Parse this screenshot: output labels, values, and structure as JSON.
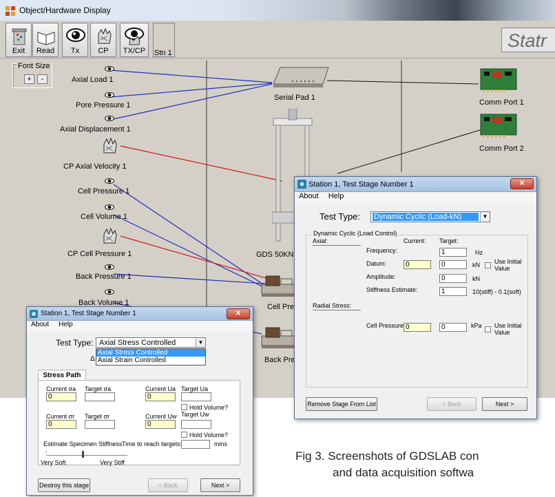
{
  "main_window": {
    "title": "Object/Hardware Display",
    "toolbar": {
      "exit": "Exit",
      "read": "Read",
      "tx": "Tx",
      "cp": "CP",
      "txcp": "TX/CP",
      "stn": "Stn 1",
      "brand_partial": "Statr"
    },
    "font_size": {
      "label": "Font Size",
      "plus": "+",
      "minus": "-"
    },
    "sensors": [
      "Axial Load 1",
      "Pore Pressure 1",
      "Axial Displacement 1",
      "CP Axial Velocity 1",
      "Cell Pressure 1",
      "Cell Volume 1",
      "CP Cell Pressure 1",
      "Back Pressure 1",
      "Back Volume 1"
    ],
    "hardware": {
      "serial_pad": "Serial Pad 1",
      "comm_port_1": "Comm Port 1",
      "comm_port_2": "Comm Port 2",
      "gds_partial": "GDS 50KN",
      "cell_pres_partial": "Cell Press",
      "back_pres_partial": "Back Pres"
    },
    "colors": {
      "blue_link": "#1f2fb8",
      "red_link": "#d01818"
    }
  },
  "dialog_dynamic": {
    "title": "Station 1, Test Stage Number 1",
    "menu": [
      "About",
      "Help"
    ],
    "test_type_label": "Test Type:",
    "test_type_value": "Dynamic Cyclic (Load-kN)",
    "group_label": "Dynamic Cyclic (Load Control)",
    "axial_label": "Axial:",
    "current_header": "Current:",
    "target_header": "Target:",
    "frequency": {
      "label": "Frequency:",
      "target": "1",
      "unit": "Hz"
    },
    "datum": {
      "label": "Datum:",
      "current": "0",
      "target": "0",
      "unit": "kN",
      "use_initial": "Use Initial Value"
    },
    "amplitude": {
      "label": "Amplitude:",
      "target": "0",
      "unit": "kN"
    },
    "stiffness": {
      "label": "Stiffness Estimate:",
      "target": "1",
      "note": "10(stiff) - 0.1(soft)"
    },
    "radial_label": "Radial Stress:",
    "cell_pressure": {
      "label": "Cell Pressure:",
      "current": "0",
      "target": "0",
      "unit": "kPa",
      "use_initial": "Use Initial Value"
    },
    "remove_button": "Remove Stage From List",
    "back_button": "< Back",
    "next_button": "Next >"
  },
  "dialog_stress": {
    "title": "Station 1, Test Stage Number 1",
    "menu": [
      "About",
      "Help"
    ],
    "test_type_label": "Test Type:",
    "test_type_value": "Axial Stress Controlled",
    "options": [
      "Axial Stress Controlled",
      "Axial Strain Controlled"
    ],
    "tab": "Stress Path",
    "current_sigma_a": "Current σa",
    "target_sigma_a": "Target σa",
    "current_ua": "Current Ua",
    "target_ua": "Target Ua",
    "current_sigma_r": "Current σr",
    "target_sigma_r": "Target σr",
    "current_uw": "Current Uw",
    "target_uw": "Target Uw",
    "hold_volume_1": "Hold Volume?",
    "hold_volume_2": "Hold Volume?",
    "val_sigma_a": "0",
    "val_ua": "0",
    "val_sigma_r": "0",
    "val_uw": "0",
    "estimate_label": "Estimate Specimen Stiffness",
    "time_label": "Time to reach targets:",
    "mins": "mins",
    "very_soft": "Very Soft",
    "very_stiff": "Very Stiff",
    "destroy_button": "Destroy this stage",
    "back_button": "< Back",
    "next_button": "Next >"
  },
  "caption": {
    "line1": "Fig 3. Screenshots of GDSLAB con",
    "line2": "and data acquisition softwa"
  }
}
